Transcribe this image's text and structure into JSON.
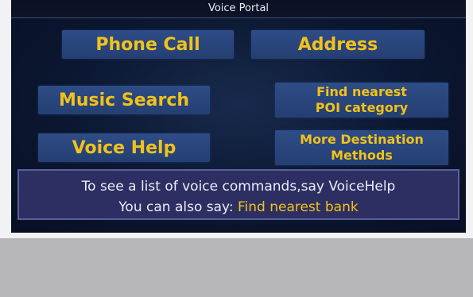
{
  "header": {
    "title": "Voice Portal"
  },
  "menu": {
    "phone_call": "Phone Call",
    "address": "Address",
    "music_search": "Music Search",
    "find_nearest_poi": "Find nearest\nPOI category",
    "voice_help": "Voice Help",
    "more_destination": "More Destination\nMethods"
  },
  "info": {
    "line1": "To see a list of voice commands,say VoiceHelp",
    "line2_prefix": "You can also say: ",
    "line2_highlight": "Find nearest bank"
  },
  "colors": {
    "button_text": "#f2c21a",
    "button_bg": "#2e4c86",
    "screen_bg": "#0b1731",
    "info_bg": "#2d2f62"
  }
}
